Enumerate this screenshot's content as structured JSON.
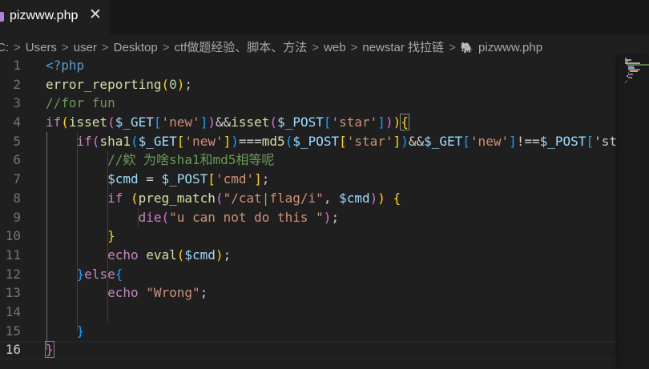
{
  "tab": {
    "title": "pizwww.php",
    "close_glyph": "✕",
    "icon": "php-file-icon"
  },
  "breadcrumb": {
    "items": [
      "C:",
      "Users",
      "user",
      "Desktop",
      "ctf做题经验、脚本、方法",
      "web",
      "newstar 找拉链",
      "pizwww.php"
    ],
    "separator": ">"
  },
  "editor": {
    "line_numbers": [
      "1",
      "2",
      "3",
      "4",
      "5",
      "6",
      "7",
      "8",
      "9",
      "10",
      "11",
      "12",
      "13",
      "14",
      "15",
      "16"
    ],
    "active_line": "16",
    "code_lines": [
      "<?php",
      "error_reporting(0);",
      "//for fun",
      "if(isset($_GET['new'])&&isset($_POST['star'])){",
      "    if(sha1($_GET['new'])===md5($_POST['star'])&&$_GET['new']!==$_POST['st",
      "        //欸 为啥sha1和md5相等呢",
      "        $cmd = $_POST['cmd'];",
      "        if (preg_match(\"/cat|flag/i\", $cmd)) {",
      "            die(\"u can not do this \");",
      "        }",
      "        echo eval($cmd);",
      "    }else{",
      "        echo \"Wrong\";",
      "",
      "    }",
      "}"
    ]
  },
  "colors": {
    "background": "#1f1f1f",
    "keyword": "#c586c0",
    "function": "#dcdcaa",
    "variable": "#9cdcfe",
    "string": "#ce9178",
    "comment": "#6a9955",
    "number": "#b5cea8",
    "bracket_level1": "#ffd700",
    "bracket_level2": "#da70d6",
    "bracket_level3": "#179fff"
  }
}
